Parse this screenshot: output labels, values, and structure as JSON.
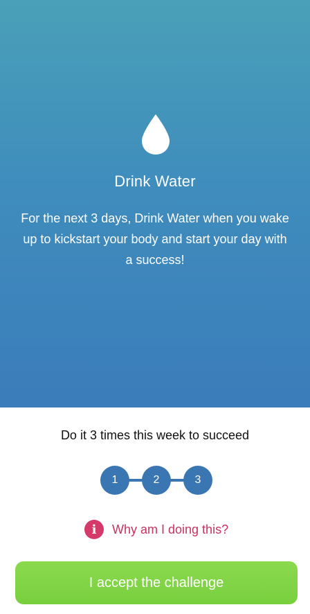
{
  "hero": {
    "title": "Drink Water",
    "description": "For the next 3 days, Drink Water when you wake up to kickstart your body and start your day with a success!",
    "background_colors": [
      "#4aa0b8",
      "#3b7cba"
    ]
  },
  "goal": {
    "text": "Do it 3 times this week to succeed",
    "steps": [
      "1",
      "2",
      "3"
    ],
    "step_color": "#3a76b1"
  },
  "why": {
    "icon": "info-icon",
    "label": "Why am I doing this?",
    "color": "#c8325e"
  },
  "cta": {
    "label": "I accept the challenge",
    "color": "#80d444"
  }
}
